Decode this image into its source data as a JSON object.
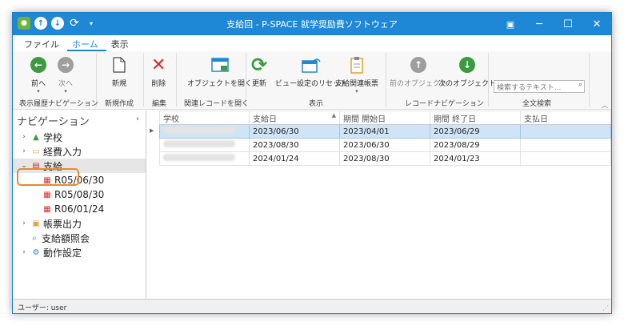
{
  "window": {
    "title": "支給回 - P-SPACE 就学奨励費ソフトウェア",
    "accent": "#1e88d6"
  },
  "menu": {
    "items": [
      "ファイル",
      "ホーム",
      "表示"
    ],
    "active": "ホーム"
  },
  "ribbon": {
    "buttons": {
      "prev": "前へ",
      "next": "次へ",
      "new": "新規",
      "delete": "削除",
      "open_object": "オブジェクトを開く",
      "refresh": "更新",
      "reset_view": "ビュー設定のリセット",
      "payment_forms": "支給関連帳票",
      "prev_object": "前のオブジェクト",
      "next_object": "次のオブジェクト"
    },
    "groups": {
      "history": "表示履歴ナビゲーション",
      "create": "新規作成",
      "edit": "編集",
      "related": "関連レコードを開く",
      "view": "表示",
      "record_nav": "レコードナビゲーション",
      "fulltext": "全文検索"
    },
    "search_placeholder": "検索するテキスト..."
  },
  "sidebar": {
    "title": "ナビゲーション",
    "items": [
      {
        "label": "学校",
        "icon": "school-icon"
      },
      {
        "label": "経費入力",
        "icon": "folder-icon"
      },
      {
        "label": "支給",
        "icon": "payment-icon"
      },
      {
        "label": "R05/06/30",
        "icon": "calendar-icon"
      },
      {
        "label": "R05/08/30",
        "icon": "calendar-icon"
      },
      {
        "label": "R06/01/24",
        "icon": "calendar-icon"
      },
      {
        "label": "帳票出力",
        "icon": "report-icon"
      },
      {
        "label": "支給額照会",
        "icon": "magnifier-icon"
      },
      {
        "label": "動作設定",
        "icon": "gear-icon"
      }
    ]
  },
  "table": {
    "columns": [
      "学校",
      "支給日",
      "期間 開始日",
      "期間 終了日",
      "支払日"
    ],
    "rows": [
      [
        "",
        "2023/06/30",
        "2023/04/01",
        "2023/06/29",
        ""
      ],
      [
        "",
        "2023/08/30",
        "2023/06/30",
        "2023/08/29",
        ""
      ],
      [
        "",
        "2024/01/24",
        "2023/08/30",
        "2024/01/23",
        ""
      ]
    ]
  },
  "status": {
    "user": "ユーザー: user"
  }
}
